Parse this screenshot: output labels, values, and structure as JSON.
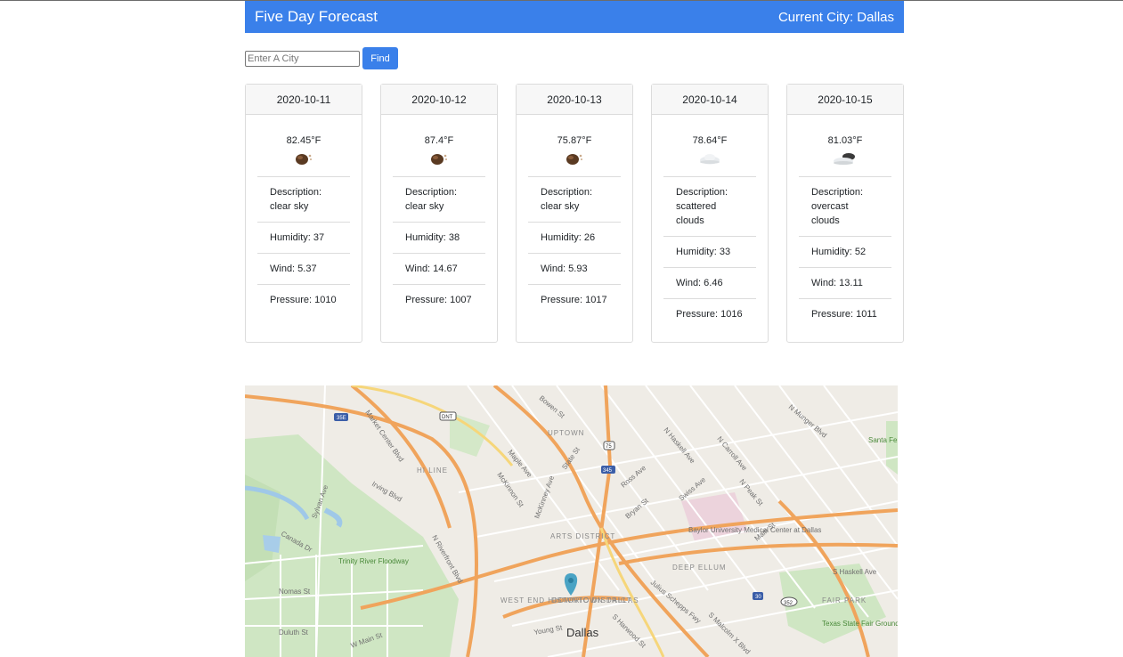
{
  "header": {
    "title": "Five Day Forecast",
    "current_city": "Current City: Dallas"
  },
  "search": {
    "placeholder": "Enter A City",
    "value": "",
    "button_label": "Find"
  },
  "forecast": [
    {
      "date": "2020-10-11",
      "temp": "82.45°F",
      "icon": "clear-sky-icon",
      "description": "Description: clear sky",
      "humidity": "Humidity: 37",
      "wind": "Wind: 5.37",
      "pressure": "Pressure: 1010"
    },
    {
      "date": "2020-10-12",
      "temp": "87.4°F",
      "icon": "clear-sky-icon",
      "description": "Description: clear sky",
      "humidity": "Humidity: 38",
      "wind": "Wind: 14.67",
      "pressure": "Pressure: 1007"
    },
    {
      "date": "2020-10-13",
      "temp": "75.87°F",
      "icon": "clear-sky-icon",
      "description": "Description: clear sky",
      "humidity": "Humidity: 26",
      "wind": "Wind: 5.93",
      "pressure": "Pressure: 1017"
    },
    {
      "date": "2020-10-14",
      "temp": "78.64°F",
      "icon": "scattered-clouds-icon",
      "description": "Description: scattered clouds",
      "humidity": "Humidity: 33",
      "wind": "Wind: 6.46",
      "pressure": "Pressure: 1016"
    },
    {
      "date": "2020-10-15",
      "temp": "81.03°F",
      "icon": "overcast-clouds-icon",
      "description": "Description: overcast clouds",
      "humidity": "Humidity: 52",
      "wind": "Wind: 13.11",
      "pressure": "Pressure: 1011"
    }
  ],
  "map": {
    "labels": {
      "city": "Dallas",
      "uptown": "UPTOWN",
      "arts_district": "ARTS DISTRICT",
      "downtown": "DOWNTOWN DALLAS",
      "west_end": "WEST END HISTORIC DISTRICT",
      "deep_ellum": "DEEP ELLUM",
      "fair_park": "FAIR PARK",
      "hi_line": "HI LINE",
      "baylor": "Baylor University Medical Center at Dallas",
      "trinity": "Trinity River Floodway",
      "fairgrounds": "Texas State Fair Grounds",
      "santa_fe": "Santa Fe Corrid",
      "s_haskell": "S Haskell Ave",
      "n_haskell": "N Haskell Ave",
      "n_carroll": "N Carroll Ave",
      "swiss": "Swiss Ave",
      "main": "Main St",
      "bryan": "Bryan St",
      "ross": "Ross Ave",
      "maple": "Maple Ave",
      "mckinnon": "McKinnon St",
      "mckinney": "McKinney Ave",
      "market_center": "Market Center Blvd",
      "irving": "Irving Blvd",
      "canada": "Canada Dr",
      "sylvan": "Sylvan Ave",
      "riverfront": "N Riverfront Blvd",
      "young": "Young St",
      "s_harwood": "S Harwood St",
      "julius": "Julius Schepps Fwy",
      "n_peak": "N Peak St",
      "n_munger": "N Munger Blvd",
      "s_malcolm": "S Malcolm X Blvd",
      "w_main": "W Main St",
      "nomas": "Nomas St",
      "duluth": "Duluth St",
      "bowen": "Bowen St",
      "state": "State St",
      "i35e": "35E",
      "i345": "345",
      "i30": "30",
      "us75": "75",
      "r352": "352",
      "dnt": "DNT"
    }
  }
}
